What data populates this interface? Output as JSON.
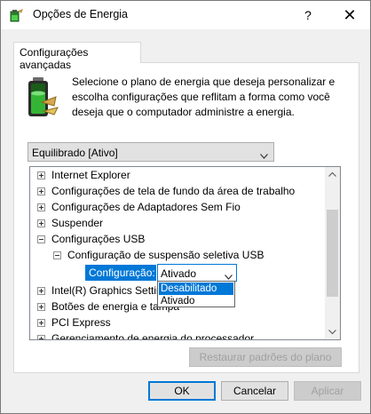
{
  "window": {
    "title": "Opções de Energia",
    "help_label": "?",
    "close_label": "✕"
  },
  "tab": {
    "label": "Configurações avançadas"
  },
  "description": "Selecione o plano de energia que deseja personalizar e escolha configurações que reflitam a forma como você deseja que o computador administre a energia.",
  "plan_select": {
    "value": "Equilibrado [Ativo]"
  },
  "tree": {
    "items": [
      {
        "label": "Internet Explorer",
        "expander": "plus"
      },
      {
        "label": "Configurações de tela de fundo da área de trabalho",
        "expander": "plus"
      },
      {
        "label": "Configurações de Adaptadores Sem Fio",
        "expander": "plus"
      },
      {
        "label": "Suspender",
        "expander": "plus"
      },
      {
        "label": "Configurações USB",
        "expander": "minus"
      },
      {
        "label": "Configuração de suspensão seletiva USB",
        "expander": "minus"
      },
      {
        "label": "Intel(R) Graphics Settings",
        "expander": "plus"
      },
      {
        "label": "Botões de energia e tampa",
        "expander": "plus"
      },
      {
        "label": "PCI Express",
        "expander": "plus"
      },
      {
        "label": "Gerenciamento de energia do processador",
        "expander": "plus"
      }
    ],
    "setting_label": "Configuração:",
    "setting_value": "Ativado"
  },
  "dropdown": {
    "options": [
      "Desabilitado",
      "Ativado"
    ],
    "highlighted": "Desabilitado"
  },
  "buttons": {
    "restore": "Restaurar padrões do plano",
    "ok": "OK",
    "cancel": "Cancelar",
    "apply": "Aplicar"
  },
  "colors": {
    "accent": "#0078d7",
    "battery_green": "#35b535"
  }
}
